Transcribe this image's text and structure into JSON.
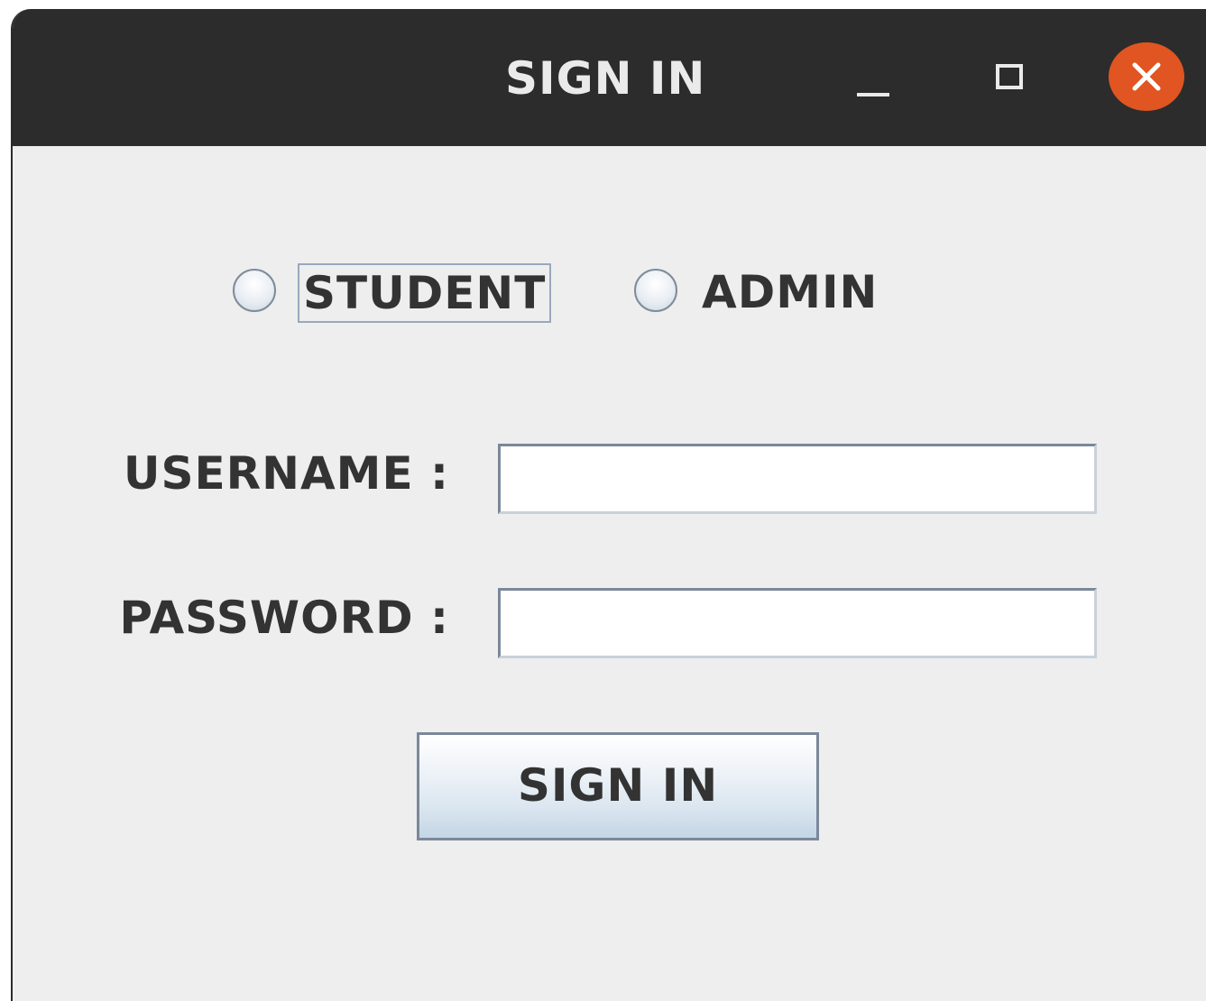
{
  "window": {
    "title": "SIGN IN",
    "controls": {
      "minimize": "minimize-icon",
      "maximize": "maximize-icon",
      "close": "close-icon",
      "close_color": "#e05521"
    }
  },
  "role": {
    "options": [
      {
        "label": "STUDENT",
        "selected": false,
        "focused": true
      },
      {
        "label": "ADMIN",
        "selected": false,
        "focused": false
      }
    ]
  },
  "form": {
    "username_label": "USERNAME :",
    "username_value": "",
    "password_label": "PASSWORD :",
    "password_value": "",
    "submit_label": "SIGN IN"
  },
  "colors": {
    "titlebar": "#2c2c2c",
    "background": "#eeeeee",
    "text": "#333333"
  }
}
